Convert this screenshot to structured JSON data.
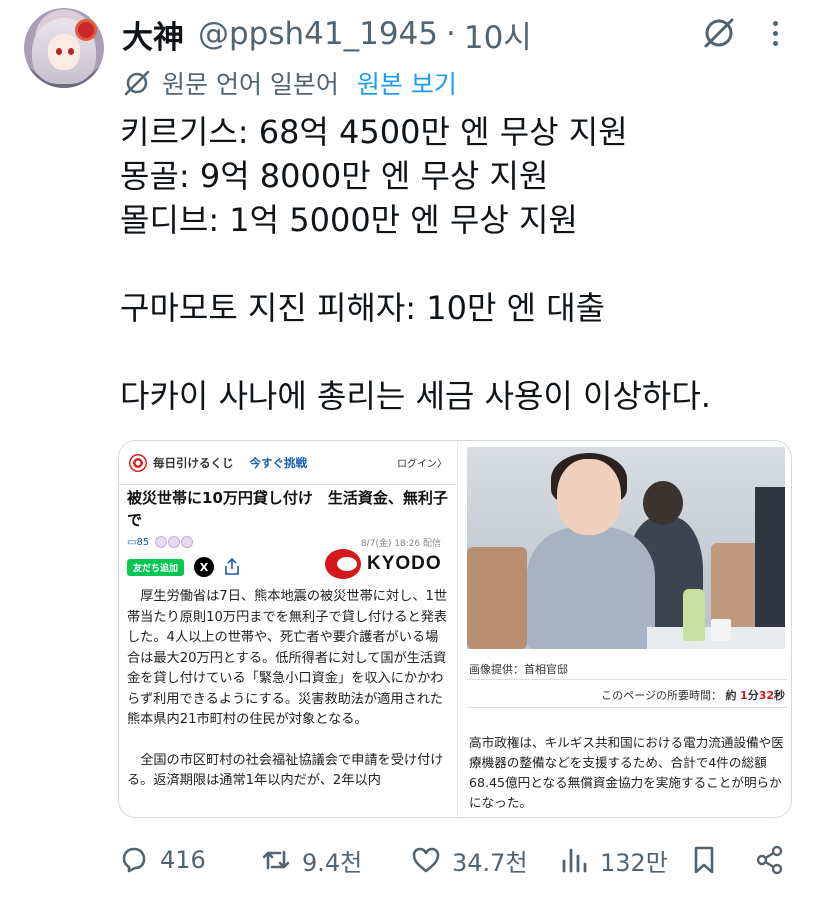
{
  "post": {
    "display_name": "大神",
    "handle": "@ppsh41_1945",
    "separator": "·",
    "time": "10시",
    "translation_note": "원문 언어 일본어",
    "show_original": "원본 보기",
    "body": "키르기스: 68억 4500만 엔 무상 지원\n몽골: 9억 8000만 엔 무상 지원\n몰디브: 1억 5000만 엔 무상 지원\n\n구마모토 지진 피해자: 10만 엔 대출\n\n다카이 사나에 총리는 세금 사용이 이상하다."
  },
  "media": {
    "left": {
      "promo": "毎日引けるくじ",
      "promo_link": "今すぐ挑戦",
      "login": "ログイン〉",
      "headline": "被災世帯に10万円貸し付け　生活資金、無利子で",
      "comment_count": "85",
      "date": "8/7(金) 18:26 配信",
      "line_button": "友だち追加",
      "x_button": "X",
      "logo_text": "KYODO",
      "paragraph1": "厚生労働省は7日、熊本地震の被災世帯に対し、1世帯当たり原則10万円までを無利子で貸し付けると発表した。4人以上の世帯や、死亡者や要介護者がいる場合は最大20万円とする。低所得者に対して国が生活資金を貸し付けている「緊急小口資金」を収入にかかわらず利用できるようにする。災害救助法が適用された熊本県内21市町村の住民が対象となる。",
      "paragraph2": "全国の市区町村の社会福祉協議会で申請を受け付ける。返済期限は通常1年以内だが、2年以内"
    },
    "right": {
      "credit": "画像提供：首相官邸",
      "read_time_label": "このページの所要時間：",
      "read_time_prefix": "約",
      "read_time_min": "1",
      "read_time_min_unit": "分",
      "read_time_sec": "32",
      "read_time_sec_unit": "秒",
      "article": "高市政権は、キルギス共和国における電力流通設備や医療機器の整備などを支援するため、合計で4件の総額68.45億円となる無償資金協力を実施することが明らかになった。"
    }
  },
  "actions": {
    "replies": "416",
    "reposts": "9.4천",
    "likes": "34.7천",
    "views": "132만"
  },
  "colors": {
    "text_primary": "#0f1419",
    "text_secondary": "#536471",
    "link": "#1d9bf0",
    "kyodo_red": "#d7161e"
  }
}
